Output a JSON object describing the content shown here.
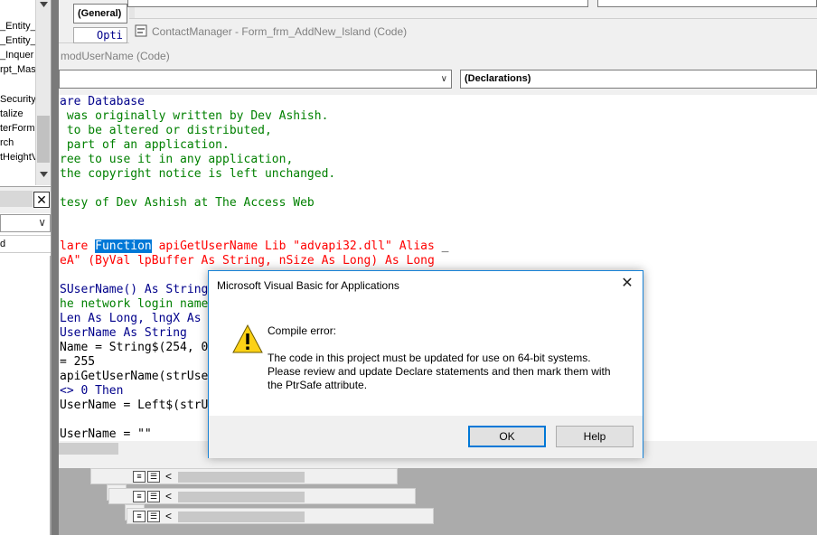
{
  "project_explorer": {
    "items": [
      "_Entity_",
      "_Entity_",
      "_Inquer",
      "rpt_Mas",
      "Security",
      "talize",
      "terForm",
      "rch",
      "tHeightV"
    ],
    "pane_close": "✕",
    "dropdown_arrow": "∨",
    "bottom_label": "d"
  },
  "back_window": {
    "object_combo": "(General)",
    "code_fragment": "Opti"
  },
  "contact_window": {
    "title": "ContactManager - Form_frm_AddNew_Island (Code)"
  },
  "code_window": {
    "title": "modUserName (Code)",
    "object_combo": "",
    "procedure_combo": "(Declarations)",
    "lines": [
      {
        "parts": [
          {
            "t": "are Database",
            "c": "blue"
          }
        ]
      },
      {
        "parts": [
          {
            "t": " was originally written by Dev Ashish.",
            "c": "green"
          }
        ]
      },
      {
        "parts": [
          {
            "t": " to be altered or distributed,",
            "c": "green"
          }
        ]
      },
      {
        "parts": [
          {
            "t": " part of an application.",
            "c": "green"
          }
        ]
      },
      {
        "parts": [
          {
            "t": "ree to use it in any application,",
            "c": "green"
          }
        ]
      },
      {
        "parts": [
          {
            "t": "the copyright notice is left unchanged.",
            "c": "green"
          }
        ]
      },
      {
        "parts": []
      },
      {
        "parts": [
          {
            "t": "tesy of Dev Ashish at The Access Web",
            "c": "green"
          }
        ]
      },
      {
        "parts": []
      },
      {
        "parts": []
      },
      {
        "parts": [
          {
            "t": "lare ",
            "c": "red"
          },
          {
            "t": "Function",
            "c": "sel"
          },
          {
            "t": " apiGetUserName Lib \"advapi32.dll\" Alias ",
            "c": "red"
          },
          {
            "t": "_",
            "c": "black"
          }
        ]
      },
      {
        "parts": [
          {
            "t": "eA\" (ByVal lpBuffer As String, nSize As Long) As Long",
            "c": "red"
          }
        ]
      },
      {
        "parts": []
      },
      {
        "parts": [
          {
            "t": "SUserName() As String",
            "c": "blue"
          }
        ]
      },
      {
        "parts": [
          {
            "t": "he network login name",
            "c": "green"
          }
        ]
      },
      {
        "parts": [
          {
            "t": "Len As Long, lngX As",
            "c": "blue"
          }
        ]
      },
      {
        "parts": [
          {
            "t": "UserName As String",
            "c": "blue"
          }
        ]
      },
      {
        "parts": [
          {
            "t": "Name = String$(254, 0",
            "c": "black"
          }
        ]
      },
      {
        "parts": [
          {
            "t": "= 255",
            "c": "black"
          }
        ]
      },
      {
        "parts": [
          {
            "t": "apiGetUserName(strUse",
            "c": "black"
          }
        ]
      },
      {
        "parts": [
          {
            "t": "<> 0 Then",
            "c": "blue"
          }
        ]
      },
      {
        "parts": [
          {
            "t": "UserName = Left$(strU",
            "c": "black"
          }
        ]
      },
      {
        "parts": []
      },
      {
        "parts": [
          {
            "t": "UserName = \"\"",
            "c": "black"
          }
        ]
      }
    ]
  },
  "minimized": {
    "scroll_left": "<"
  },
  "dialog": {
    "title": "Microsoft Visual Basic for Applications",
    "close": "✕",
    "icon": "warning-icon",
    "heading": "Compile error:",
    "message": "The code in this project must be updated for use on 64-bit systems.\nPlease review and update Declare statements and then mark them with\nthe PtrSafe attribute.",
    "ok_label": "OK",
    "help_label": "Help"
  },
  "colors": {
    "comment": "#008000",
    "keyword": "#00008b",
    "error_line": "#ff0000",
    "selection": "#0078d7",
    "dialog_border": "#1883d7"
  }
}
